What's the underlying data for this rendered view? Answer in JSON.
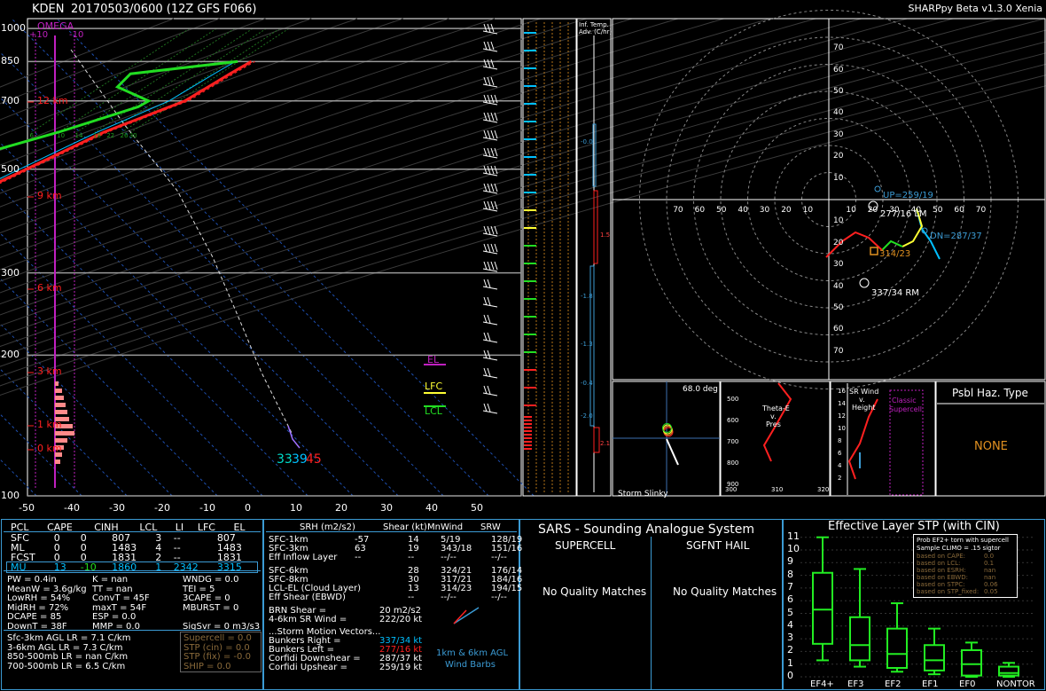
{
  "header": {
    "station": "KDEN",
    "run": "20170503/0600  (12Z  GFS  F066)",
    "version": "SHARPpy Beta v1.3.0 Xenia"
  },
  "colors": {
    "temp": "#ff2020",
    "dew": "#22dd22",
    "wet": "#00bfff",
    "accent": "#3b9bd4",
    "magenta": "#c020c0",
    "yellow": "#ffff33",
    "orange": "#e09020"
  },
  "skewt": {
    "p_ticks": [
      "100",
      "200",
      "300",
      "500",
      "700",
      "850",
      "1000"
    ],
    "t_ticks": [
      "-50",
      "-40",
      "-30",
      "-20",
      "-10",
      "0",
      "10",
      "20",
      "30",
      "40",
      "50"
    ],
    "height_labels": [
      "12 km",
      "9 km",
      "6 km",
      "3 km",
      "1 km",
      "0 km"
    ],
    "omega_label": "OMEGA",
    "omega_ticks": [
      "+10",
      "-10"
    ],
    "levels": {
      "el": "EL",
      "lfc": "LFC",
      "lcl": "LCL"
    },
    "sfc_values": {
      "wetbulb": "33",
      "dewpoint_t": "39",
      "temp": "45"
    },
    "mix_labels": [
      "6",
      "10",
      "14",
      "18",
      "22",
      "26",
      "30"
    ],
    "temp_profile": [
      [
        100,
        -58
      ],
      [
        150,
        -56
      ],
      [
        200,
        -50
      ],
      [
        250,
        -47
      ],
      [
        300,
        -43
      ],
      [
        400,
        -30
      ],
      [
        500,
        -19
      ],
      [
        600,
        -10
      ],
      [
        700,
        1
      ],
      [
        800,
        5
      ],
      [
        850,
        7
      ]
    ],
    "dew_profile": [
      [
        100,
        -90
      ],
      [
        150,
        -82
      ],
      [
        200,
        -65
      ],
      [
        230,
        -62
      ],
      [
        250,
        -70
      ],
      [
        300,
        -67
      ],
      [
        400,
        -57
      ],
      [
        480,
        -48
      ],
      [
        500,
        -47
      ],
      [
        540,
        -32
      ],
      [
        600,
        -20
      ],
      [
        680,
        -8
      ],
      [
        700,
        -7
      ],
      [
        750,
        -17
      ],
      [
        800,
        -17
      ],
      [
        850,
        4
      ]
    ]
  },
  "inf_temp_adv": {
    "title": "Inf. Temp.",
    "subtitle": "Adv. (C/hr)",
    "values": [
      "-0.0",
      "1.5",
      "-1.8",
      "-1.3",
      "-0.4",
      "-2.0",
      "2.1"
    ]
  },
  "hodograph": {
    "rings": [
      "10",
      "20",
      "30",
      "40",
      "50",
      "60",
      "70"
    ],
    "up": "UP=259/19",
    "dn": "DN=287/37",
    "lm": "277/16 LM",
    "rm": "337/34 RM",
    "mean": "314/23"
  },
  "slinky": {
    "angle": "68.0 deg",
    "label": "Storm Slinky"
  },
  "theta": {
    "title_lines": [
      "Theta-E",
      "v.",
      "Pres"
    ],
    "p_ticks": [
      "500",
      "600",
      "700",
      "800",
      "900"
    ],
    "x_ticks": [
      "300",
      "310",
      "320"
    ]
  },
  "srwind": {
    "title_lines": [
      "SR Wind",
      "v.",
      "Height"
    ],
    "classic": "Classic",
    "supercell": "Supercell",
    "y_ticks": [
      "16",
      "14",
      "12",
      "10",
      "8",
      "6",
      "4",
      "2"
    ]
  },
  "hazard": {
    "title": "Psbl Haz. Type",
    "value": "NONE"
  },
  "parcels": {
    "headers": [
      "PCL",
      "CAPE",
      "CINH",
      "LCL",
      "LI",
      "LFC",
      "EL"
    ],
    "rows": [
      [
        "SFC",
        "0",
        "0",
        "807",
        "3",
        "--",
        "807"
      ],
      [
        "ML",
        "0",
        "0",
        "1483",
        "4",
        "--",
        "1483"
      ],
      [
        "FCST",
        "0",
        "0",
        "1831",
        "2",
        "--",
        "1831"
      ],
      [
        "MU",
        "13",
        "-10",
        "1860",
        "1",
        "2342",
        "3315"
      ]
    ]
  },
  "indices": [
    [
      "PW = 0.4in",
      "K = nan",
      "WNDG = 0.0"
    ],
    [
      "MeanW = 3.6g/kg",
      "TT = nan",
      "TEI = 5"
    ],
    [
      "LowRH = 54%",
      "ConvT = 45F",
      "3CAPE = 0"
    ],
    [
      "MidRH = 72%",
      "maxT = 54F",
      "MBURST = 0"
    ],
    [
      "DCAPE = 85",
      "ESP = 0.0",
      ""
    ],
    [
      "DownT = 38F",
      "MMP = 0.0",
      "SigSvr = 0 m3/s3"
    ]
  ],
  "lapse": [
    "Sfc-3km AGL LR = 7.1 C/km",
    "3-6km AGL LR = 7.3 C/km",
    "850-500mb LR = nan C/km",
    "700-500mb LR = 6.5 C/km"
  ],
  "composite": [
    "Supercell = 0.0",
    "STP (cin) = 0.0",
    "STP (fix) = -0.0",
    "SHIP = 0.0"
  ],
  "kinematics": {
    "headers": [
      "SRH (m2/s2)",
      "Shear (kt)",
      "MnWind",
      "SRW"
    ],
    "rows": [
      [
        "SFC-1km",
        "-57",
        "14",
        "5/19",
        "128/19"
      ],
      [
        "SFC-3km",
        "63",
        "19",
        "343/18",
        "151/16"
      ],
      [
        "Eff Inflow Layer",
        "--",
        "--",
        "--/--",
        "--/--"
      ],
      [
        "SFC-6km",
        "",
        "28",
        "324/21",
        "176/14"
      ],
      [
        "SFC-8km",
        "",
        "30",
        "317/21",
        "184/16"
      ],
      [
        "LCL-EL (Cloud Layer)",
        "",
        "13",
        "314/23",
        "194/15"
      ],
      [
        "Eff Shear (EBWD)",
        "",
        "--",
        "--/--",
        "--/--"
      ]
    ],
    "brn_shear_label": "BRN Shear =",
    "brn_shear": "20 m2/s2",
    "sr_wind_label": "4-6km SR Wind =",
    "sr_wind": "222/20 kt",
    "vectors_title": "...Storm Motion Vectors...",
    "vectors": [
      [
        "Bunkers Right =",
        "337/34 kt"
      ],
      [
        "Bunkers Left =",
        "277/16 kt"
      ],
      [
        "Corfidi Downshear =",
        "287/37 kt"
      ],
      [
        "Corfidi Upshear =",
        "259/19 kt"
      ]
    ],
    "barb_note": [
      "1km & 6km AGL",
      "Wind Barbs"
    ]
  },
  "sars": {
    "title": "SARS - Sounding Analogue System",
    "supercell": "SUPERCELL",
    "hail": "SGFNT HAIL",
    "supercell_result": "No Quality Matches",
    "hail_result": "No Quality Matches"
  },
  "stp": {
    "title": "Effective Layer STP (with CIN)",
    "legend_title": "Prob EF2+ torn with supercell",
    "legend_sub": "Sample CLIMO = .15 sigtor",
    "legend_rows": [
      [
        "based on CAPE:",
        "0.0"
      ],
      [
        "based on LCL:",
        "0.1"
      ],
      [
        "based on ESRH:",
        "nan"
      ],
      [
        "based on EBWD:",
        "nan"
      ],
      [
        "based on STPC:",
        "0.06"
      ],
      [
        "based on STP_fixed:",
        "0.05"
      ]
    ],
    "y_ticks": [
      "0",
      "1",
      "2",
      "3",
      "4",
      "5",
      "6",
      "7",
      "8",
      "9",
      "10",
      "11"
    ],
    "categories": [
      "EF4+",
      "EF3",
      "EF2",
      "EF1",
      "EF0",
      "NONTOR"
    ]
  },
  "chart_data": [
    {
      "type": "line",
      "title": "Skew-T",
      "xlabel": "",
      "ylabel": "",
      "ylim": [
        1000,
        100
      ],
      "xlim": [
        -50,
        50
      ],
      "series": [
        {
          "name": "Temperature",
          "values": [
            [
              100,
              -58
            ],
            [
              150,
              -56
            ],
            [
              200,
              -50
            ],
            [
              250,
              -47
            ],
            [
              300,
              -43
            ],
            [
              400,
              -30
            ],
            [
              500,
              -19
            ],
            [
              600,
              -10
            ],
            [
              700,
              1
            ],
            [
              800,
              5
            ],
            [
              850,
              7
            ]
          ]
        },
        {
          "name": "Dewpoint",
          "values": [
            [
              100,
              -90
            ],
            [
              150,
              -82
            ],
            [
              200,
              -65
            ],
            [
              230,
              -62
            ],
            [
              250,
              -70
            ],
            [
              300,
              -67
            ],
            [
              400,
              -57
            ],
            [
              480,
              -48
            ],
            [
              500,
              -47
            ],
            [
              540,
              -32
            ],
            [
              600,
              -20
            ],
            [
              680,
              -8
            ],
            [
              700,
              -7
            ],
            [
              750,
              -17
            ],
            [
              800,
              -17
            ],
            [
              850,
              4
            ]
          ]
        }
      ]
    },
    {
      "type": "bar",
      "title": "Effective Layer STP (with CIN)",
      "categories": [
        "EF4+",
        "EF3",
        "EF2",
        "EF1",
        "EF0",
        "NONTOR"
      ],
      "values": [
        [
          1.3,
          2.6,
          5.3,
          8.2,
          11.0
        ],
        [
          0.8,
          1.3,
          2.5,
          4.7,
          8.5
        ],
        [
          0.4,
          0.7,
          1.8,
          3.8,
          5.8
        ],
        [
          0.2,
          0.5,
          1.3,
          2.5,
          3.8
        ],
        [
          0.0,
          0.1,
          1.0,
          2.1,
          2.7
        ],
        [
          0.0,
          0.1,
          0.3,
          0.8,
          1.1
        ]
      ],
      "ylim": [
        0,
        11
      ]
    }
  ]
}
